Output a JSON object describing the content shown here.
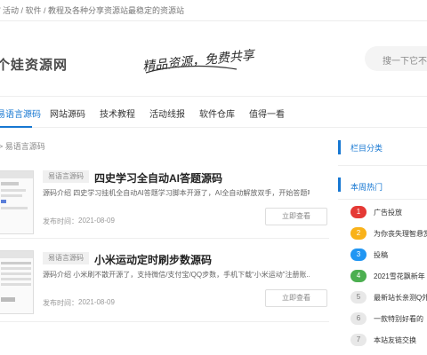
{
  "topbar": {
    "text": "/ 活动 / 软件 / 教程及各种分享资源站最稳定的资源站"
  },
  "brand": {
    "logo_text": "个娃资源网",
    "slogan": "精品资源，免费共享"
  },
  "search": {
    "placeholder": "搜一下它不香吗"
  },
  "nav": {
    "items": [
      "易语言源码",
      "网站源码",
      "技术教程",
      "活动线报",
      "软件仓库",
      "值得一看"
    ],
    "active_index": 0
  },
  "breadcrumb": "> 易语言源码",
  "posts": [
    {
      "tag": "易语言源码",
      "title": "四史学习全自动AI答题源码",
      "desc": "源码介绍 四史学习挂机全自动AI答题学习脚本开源了，AI全自动解放双手，开始答题啦...",
      "date_label": "发布时间：",
      "date": "2021-08-09",
      "button": "立即查看"
    },
    {
      "tag": "易语言源码",
      "title": "小米运动定时刷步数源码",
      "desc": "源码介绍 小米刷不散开源了，支持微信/支付宝/QQ步数，手机下载“小米运动”注册账...",
      "date_label": "发布时间：",
      "date": "2021-08-09",
      "button": "立即查看"
    }
  ],
  "sidebar": {
    "category_title": "栏目分类",
    "hot_title": "本周热门",
    "hot_items": [
      {
        "rank": "1",
        "text": "广告投放",
        "color": "#e53935"
      },
      {
        "rank": "2",
        "text": "为你丧失理智悬赏",
        "color": "#f9b21a"
      },
      {
        "rank": "3",
        "text": "投稿",
        "color": "#2196f3"
      },
      {
        "rank": "4",
        "text": "2021雪花飘新年",
        "color": "#4caf50"
      },
      {
        "rank": "5",
        "text": "最新站长亲测Q外",
        "color": "#e8e8e8"
      },
      {
        "rank": "6",
        "text": "一款特别好看的",
        "color": "#e8e8e8"
      },
      {
        "rank": "7",
        "text": "本站友链交换",
        "color": "#e8e8e8"
      }
    ]
  },
  "colors": {
    "accent": "#1677d2"
  }
}
